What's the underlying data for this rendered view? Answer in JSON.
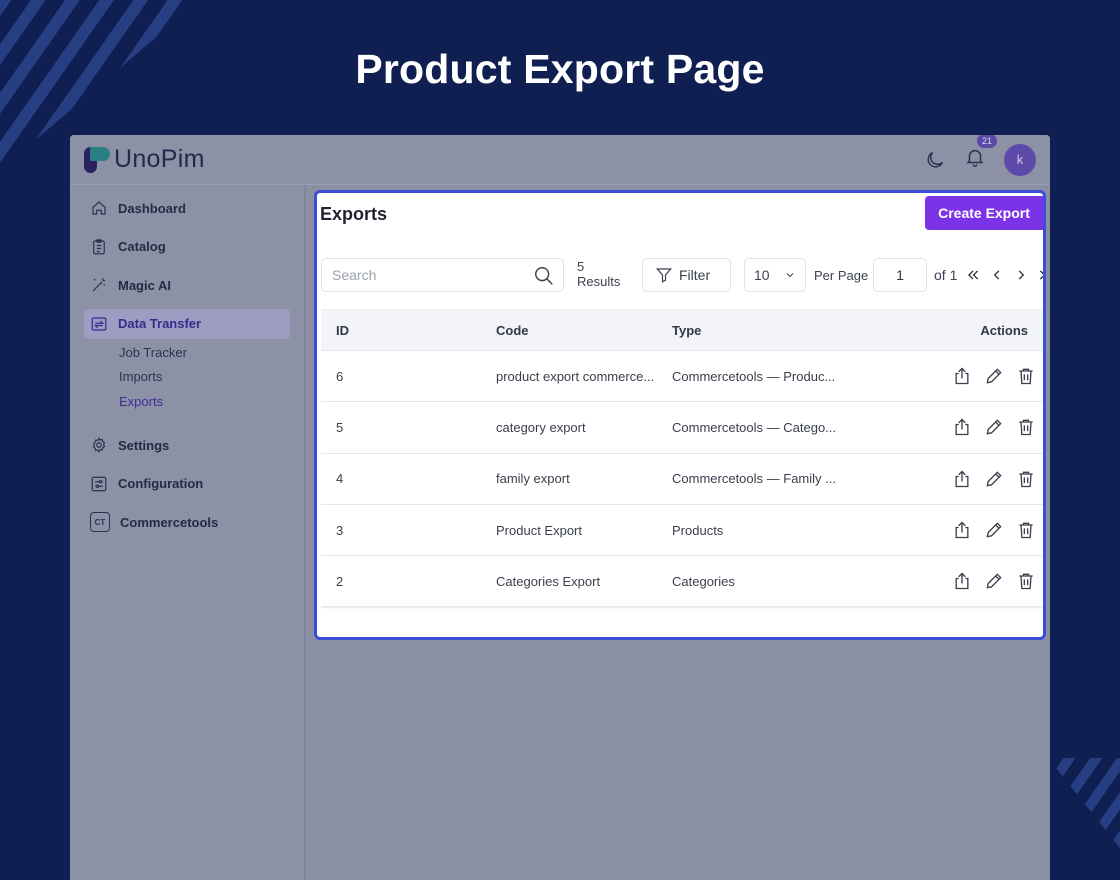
{
  "page": {
    "heading": "Product Export Page"
  },
  "app": {
    "logo": {
      "text": "UnoPim"
    },
    "notifications": {
      "count": "21"
    },
    "user": {
      "initial": "k"
    }
  },
  "sidebar": {
    "items": [
      {
        "label": "Dashboard",
        "icon": "home-icon"
      },
      {
        "label": "Catalog",
        "icon": "clipboard-icon"
      },
      {
        "label": "Magic AI",
        "icon": "magic-wand-icon"
      },
      {
        "label": "Data Transfer",
        "icon": "data-transfer-icon",
        "active": true
      },
      {
        "label": "Settings",
        "icon": "gear-icon"
      },
      {
        "label": "Configuration",
        "icon": "sliders-icon"
      },
      {
        "label": "Commercetools",
        "icon": "ct-icon",
        "icon_text": "CT"
      }
    ],
    "data_transfer_children": [
      {
        "label": "Job Tracker"
      },
      {
        "label": "Imports"
      },
      {
        "label": "Exports",
        "active": true
      }
    ]
  },
  "exports": {
    "title": "Exports",
    "create_button": "Create Export",
    "search_placeholder": "Search",
    "results_count": "5",
    "results_label": "Results",
    "filter_label": "Filter",
    "per_page_value": "10",
    "per_page_label": "Per Page",
    "current_page": "1",
    "page_total_label": "of 1",
    "columns": {
      "id": "ID",
      "code": "Code",
      "type": "Type",
      "actions": "Actions"
    },
    "rows": [
      {
        "id": "6",
        "code": "product export commerce...",
        "type": "Commercetools — Produc..."
      },
      {
        "id": "5",
        "code": "category export",
        "type": "Commercetools — Catego..."
      },
      {
        "id": "4",
        "code": "family export",
        "type": "Commercetools — Family ..."
      },
      {
        "id": "3",
        "code": "Product Export",
        "type": "Products"
      },
      {
        "id": "2",
        "code": "Categories Export",
        "type": "Categories"
      }
    ]
  },
  "colors": {
    "accent": "#7c33e8",
    "highlight_border": "#3a4fd6",
    "background": "#0f1f52"
  }
}
